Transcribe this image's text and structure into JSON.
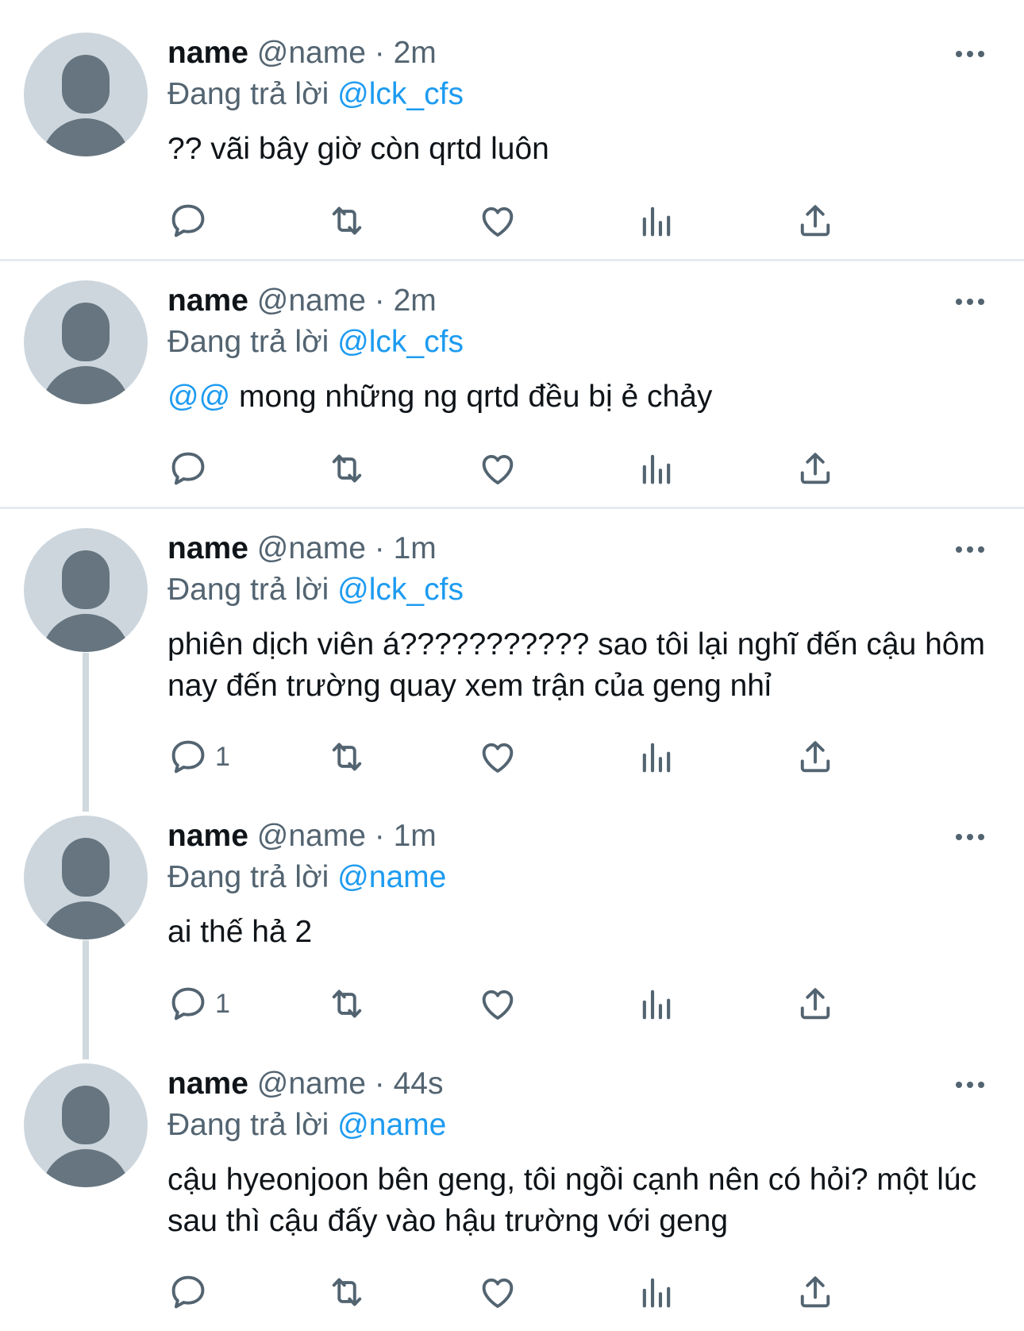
{
  "tweets": [
    {
      "name": "name",
      "handle": "@name",
      "time": "2m",
      "replying_prefix": "Đang trả lời",
      "replying_to": "@lck_cfs",
      "text_mention": "",
      "text": "?? vãi bây giờ còn qrtd luôn",
      "reply_count": ""
    },
    {
      "name": "name",
      "handle": "@name",
      "time": "2m",
      "replying_prefix": "Đang trả lời",
      "replying_to": "@lck_cfs",
      "text_mention": "@@",
      "text": " mong những ng qrtd đều bị ẻ chảy",
      "reply_count": ""
    },
    {
      "name": "name",
      "handle": "@name",
      "time": "1m",
      "replying_prefix": "Đang trả lời",
      "replying_to": "@lck_cfs",
      "text_mention": "",
      "text": "phiên dịch viên á??????????? sao tôi lại nghĩ đến cậu hôm nay đến trường quay xem trận của geng nhỉ",
      "reply_count": "1"
    },
    {
      "name": "name",
      "handle": "@name",
      "time": "1m",
      "replying_prefix": "Đang trả lời",
      "replying_to": "@name",
      "text_mention": "",
      "text": "ai thế hả 2",
      "reply_count": "1"
    },
    {
      "name": "name",
      "handle": "@name",
      "time": "44s",
      "replying_prefix": "Đang trả lời",
      "replying_to": "@name",
      "text_mention": "",
      "text": "cậu hyeonjoon bên geng, tôi ngồi cạnh nên có hỏi? một lúc sau thì cậu đấy vào hậu trường với geng",
      "reply_count": ""
    }
  ],
  "separator": "·",
  "icons": {
    "reply": "reply-icon",
    "retweet": "retweet-icon",
    "like": "heart-icon",
    "views": "views-icon",
    "share": "share-icon",
    "more": "more-icon"
  },
  "colors": {
    "mention": "#1d9bf0",
    "secondary_text": "#536471",
    "primary_text": "#0f1419",
    "avatar_bg": "#cdd6dd",
    "avatar_fg": "#66757f",
    "thread_line": "#cfd9de"
  }
}
